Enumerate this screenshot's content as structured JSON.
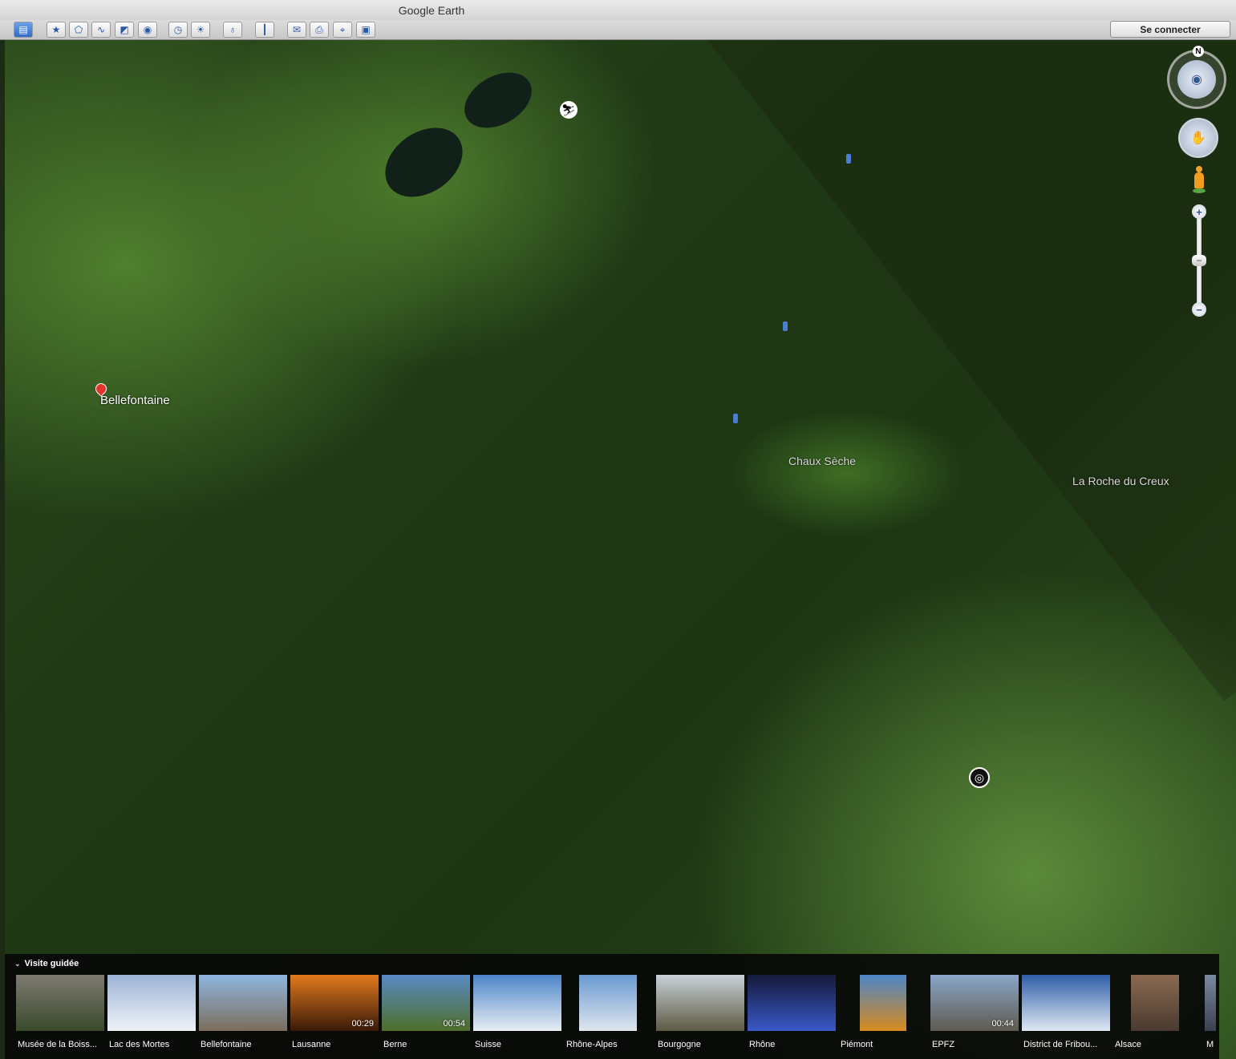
{
  "window": {
    "title": "Google Earth"
  },
  "toolbar": {
    "buttons": [
      {
        "icon": "sidebar-icon",
        "glyph": "▤"
      },
      {
        "icon": "add-placemark-icon",
        "glyph": "★"
      },
      {
        "icon": "add-polygon-icon",
        "glyph": "⬠"
      },
      {
        "icon": "add-path-icon",
        "glyph": "∿"
      },
      {
        "icon": "add-image-overlay-icon",
        "glyph": "◩"
      },
      {
        "icon": "record-tour-icon",
        "glyph": "◉"
      },
      {
        "icon": "historical-imagery-icon",
        "glyph": "◷"
      },
      {
        "icon": "sunlight-icon",
        "glyph": "☀"
      },
      {
        "icon": "planets-icon",
        "glyph": "♁"
      },
      {
        "icon": "ruler-icon",
        "glyph": "┃"
      },
      {
        "icon": "email-icon",
        "glyph": "✉"
      },
      {
        "icon": "print-icon",
        "glyph": "⎙"
      },
      {
        "icon": "view-in-maps-icon",
        "glyph": "⌖"
      },
      {
        "icon": "save-image-icon",
        "glyph": "▣"
      }
    ],
    "signin_label": "Se connecter"
  },
  "map": {
    "labels": {
      "bellefontaine": "Bellefontaine",
      "chaux_seche": "Chaux Sèche",
      "roche_du_creux": "La Roche du Creux"
    },
    "nav": {
      "north": "N",
      "zoom_in": "+",
      "zoom_out": "−"
    }
  },
  "tour": {
    "title": "Visite guidée",
    "items": [
      {
        "label": "Musée de la Boiss...",
        "duration": "",
        "colors": [
          "#7e7a72",
          "#3a4a2c"
        ]
      },
      {
        "label": "Lac des Mortes",
        "duration": "",
        "colors": [
          "#9db3d6",
          "#eef2f6"
        ]
      },
      {
        "label": "Bellefontaine",
        "duration": "",
        "colors": [
          "#8fb6e0",
          "#7b6d5c"
        ]
      },
      {
        "label": "Lausanne",
        "duration": "00:29",
        "colors": [
          "#e27a1d",
          "#3a1a08"
        ]
      },
      {
        "label": "Berne",
        "duration": "00:54",
        "colors": [
          "#5a8ac4",
          "#4e6e2a"
        ]
      },
      {
        "label": "Suisse",
        "duration": "",
        "colors": [
          "#4c84c8",
          "#e8eef4"
        ]
      },
      {
        "label": "Rhône-Alpes",
        "duration": "",
        "colors": [
          "#6a9ad2",
          "#dfe6ee"
        ]
      },
      {
        "label": "Bourgogne",
        "duration": "",
        "colors": [
          "#c8d2d8",
          "#5e5a44"
        ]
      },
      {
        "label": "Rhône",
        "duration": "",
        "colors": [
          "#141a3a",
          "#3a58c8"
        ]
      },
      {
        "label": "Piémont",
        "duration": "",
        "colors": [
          "#4c86c8",
          "#d88a1e"
        ]
      },
      {
        "label": "EPFZ",
        "duration": "00:44",
        "colors": [
          "#8aa6c8",
          "#5e5a50"
        ]
      },
      {
        "label": "District de Fribou...",
        "duration": "",
        "colors": [
          "#2f5ea8",
          "#dfe8f2"
        ]
      },
      {
        "label": "Alsace",
        "duration": "",
        "colors": [
          "#8a6a50",
          "#4a3a30"
        ]
      },
      {
        "label": "M",
        "duration": "",
        "colors": [
          "#7a8aa0",
          "#3a4050"
        ]
      }
    ]
  }
}
